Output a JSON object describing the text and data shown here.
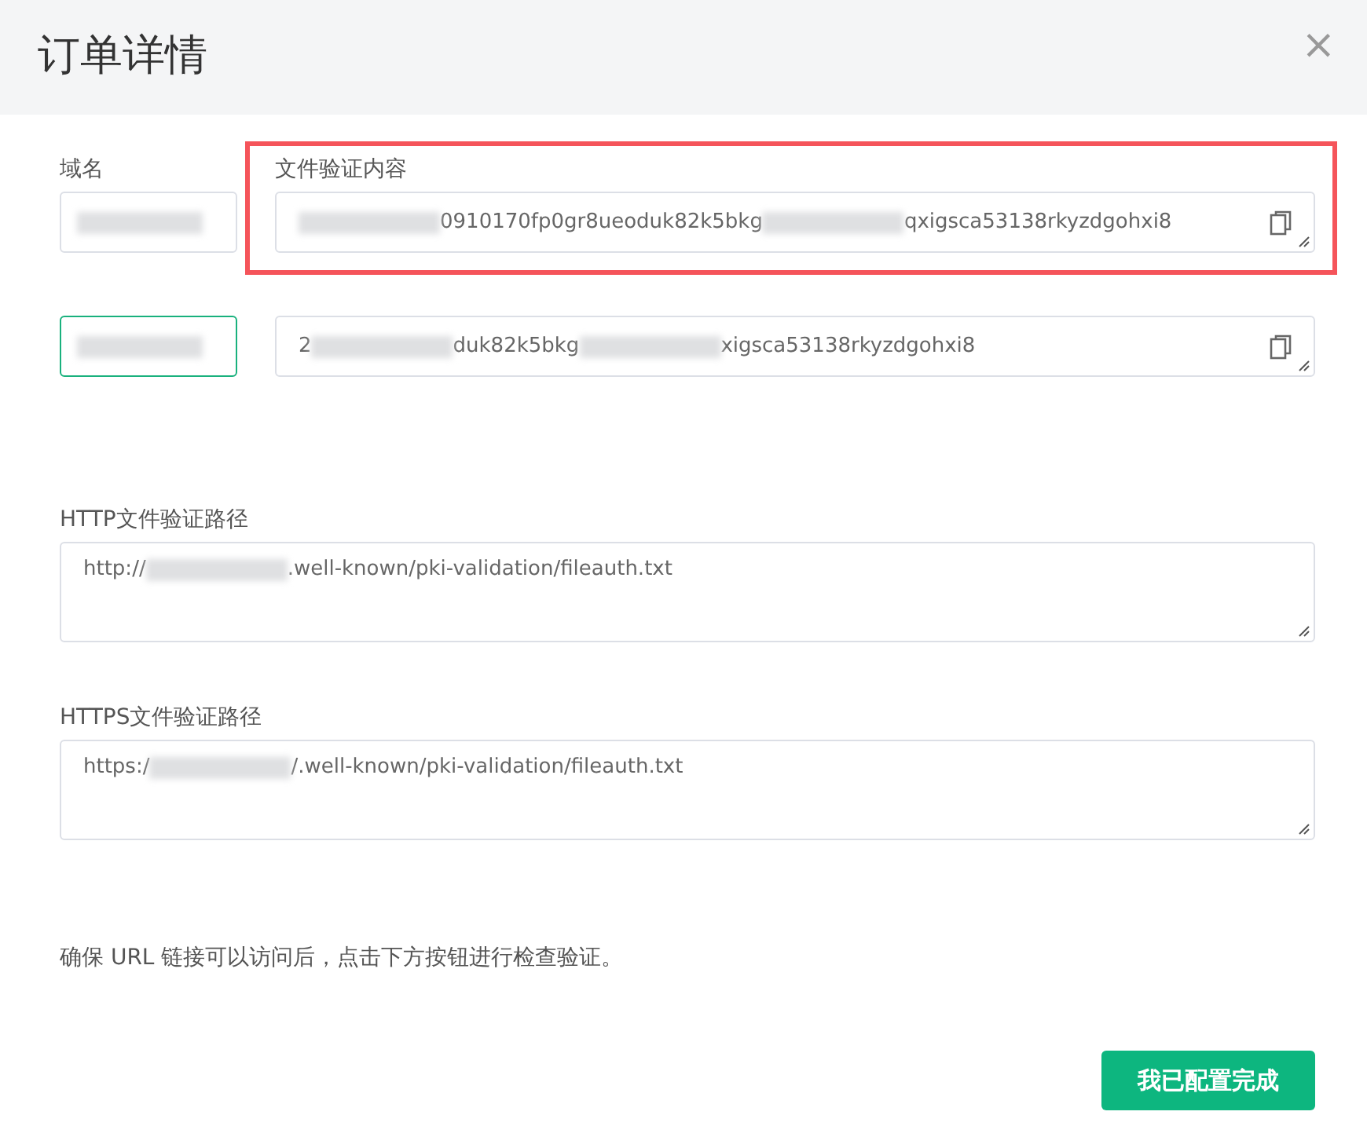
{
  "dialog": {
    "title": "订单详情",
    "close": "×"
  },
  "rows": [
    {
      "domain_label": "域名",
      "domain_focused": false,
      "content_label": "文件验证内容",
      "highlighted": true,
      "segments": [
        {
          "kind": "blur"
        },
        {
          "kind": "text",
          "text": "0910170fp0gr8ueoduk82k5bkg"
        },
        {
          "kind": "blur"
        },
        {
          "kind": "text",
          "text": "qxigsca53138rkyzdgohxi8"
        }
      ]
    },
    {
      "domain_focused": true,
      "highlighted": false,
      "segments": [
        {
          "kind": "text",
          "text": "2"
        },
        {
          "kind": "blur"
        },
        {
          "kind": "text",
          "text": "duk82k5bkg"
        },
        {
          "kind": "blur"
        },
        {
          "kind": "text",
          "text": "xigsca53138rkyzdgohxi8"
        }
      ]
    }
  ],
  "paths": [
    {
      "label": "HTTP文件验证路径",
      "segments": [
        {
          "kind": "text",
          "text": "http://"
        },
        {
          "kind": "blur"
        },
        {
          "kind": "text",
          "text": ".well-known/pki-validation/fileauth.txt"
        }
      ]
    },
    {
      "label": "HTTPS文件验证路径",
      "segments": [
        {
          "kind": "text",
          "text": "https:/"
        },
        {
          "kind": "blur"
        },
        {
          "kind": "text",
          "text": "/.well-known/pki-validation/fileauth.txt"
        }
      ]
    }
  ],
  "note": "确保 URL 链接可以访问后，点击下方按钮进行检查验证。",
  "button": "我已配置完成"
}
